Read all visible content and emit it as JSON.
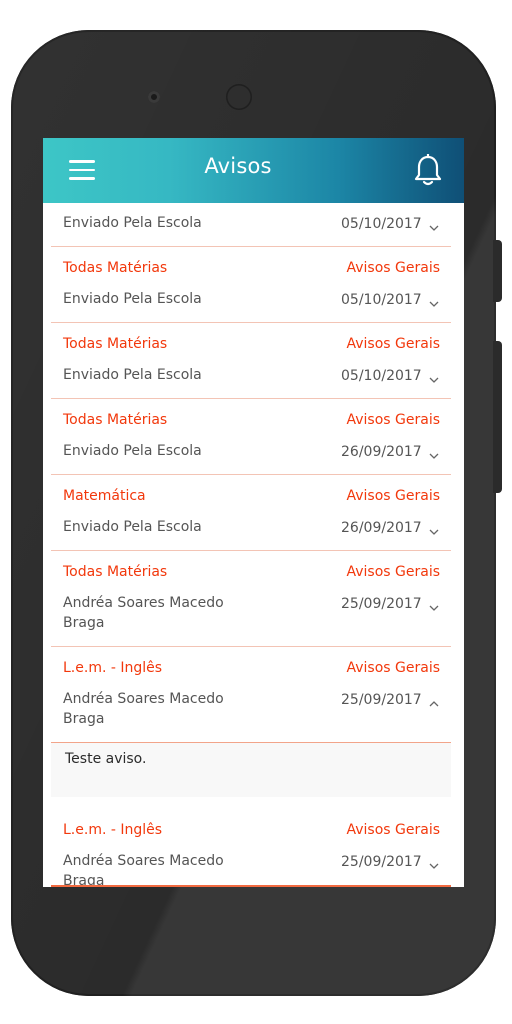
{
  "app": {
    "title": "Avisos"
  },
  "notices": [
    {
      "subject": "",
      "category": "",
      "sender": "Enviado Pela Escola",
      "date": "05/10/2017",
      "expanded": false
    },
    {
      "subject": "Todas Matérias",
      "category": "Avisos Gerais",
      "sender": "Enviado Pela Escola",
      "date": "05/10/2017",
      "expanded": false
    },
    {
      "subject": "Todas Matérias",
      "category": "Avisos Gerais",
      "sender": "Enviado Pela Escola",
      "date": "05/10/2017",
      "expanded": false
    },
    {
      "subject": "Todas Matérias",
      "category": "Avisos Gerais",
      "sender": "Enviado Pela Escola",
      "date": "26/09/2017",
      "expanded": false
    },
    {
      "subject": "Matemática",
      "category": "Avisos Gerais",
      "sender": "Enviado Pela Escola",
      "date": "26/09/2017",
      "expanded": false
    },
    {
      "subject": "Todas Matérias",
      "category": "Avisos Gerais",
      "sender": "Andréa Soares Macedo Braga",
      "date": "25/09/2017",
      "expanded": false
    },
    {
      "subject": "L.e.m. - Inglês",
      "category": "Avisos Gerais",
      "sender": "Andréa Soares Macedo Braga",
      "date": "25/09/2017",
      "expanded": true,
      "message": "Teste aviso."
    },
    {
      "subject": "L.e.m. - Inglês",
      "category": "Avisos Gerais",
      "sender": "Andréa Soares Macedo Braga",
      "date": "25/09/2017",
      "expanded": false
    }
  ],
  "colors": {
    "accent": "#f2380c",
    "header_start": "#3dc6c6",
    "header_end": "#0f4f76"
  },
  "icons": {
    "menu": "hamburger-menu-icon",
    "notifications": "bell-icon",
    "expand": "chevron-down-icon",
    "collapse": "chevron-up-icon"
  }
}
